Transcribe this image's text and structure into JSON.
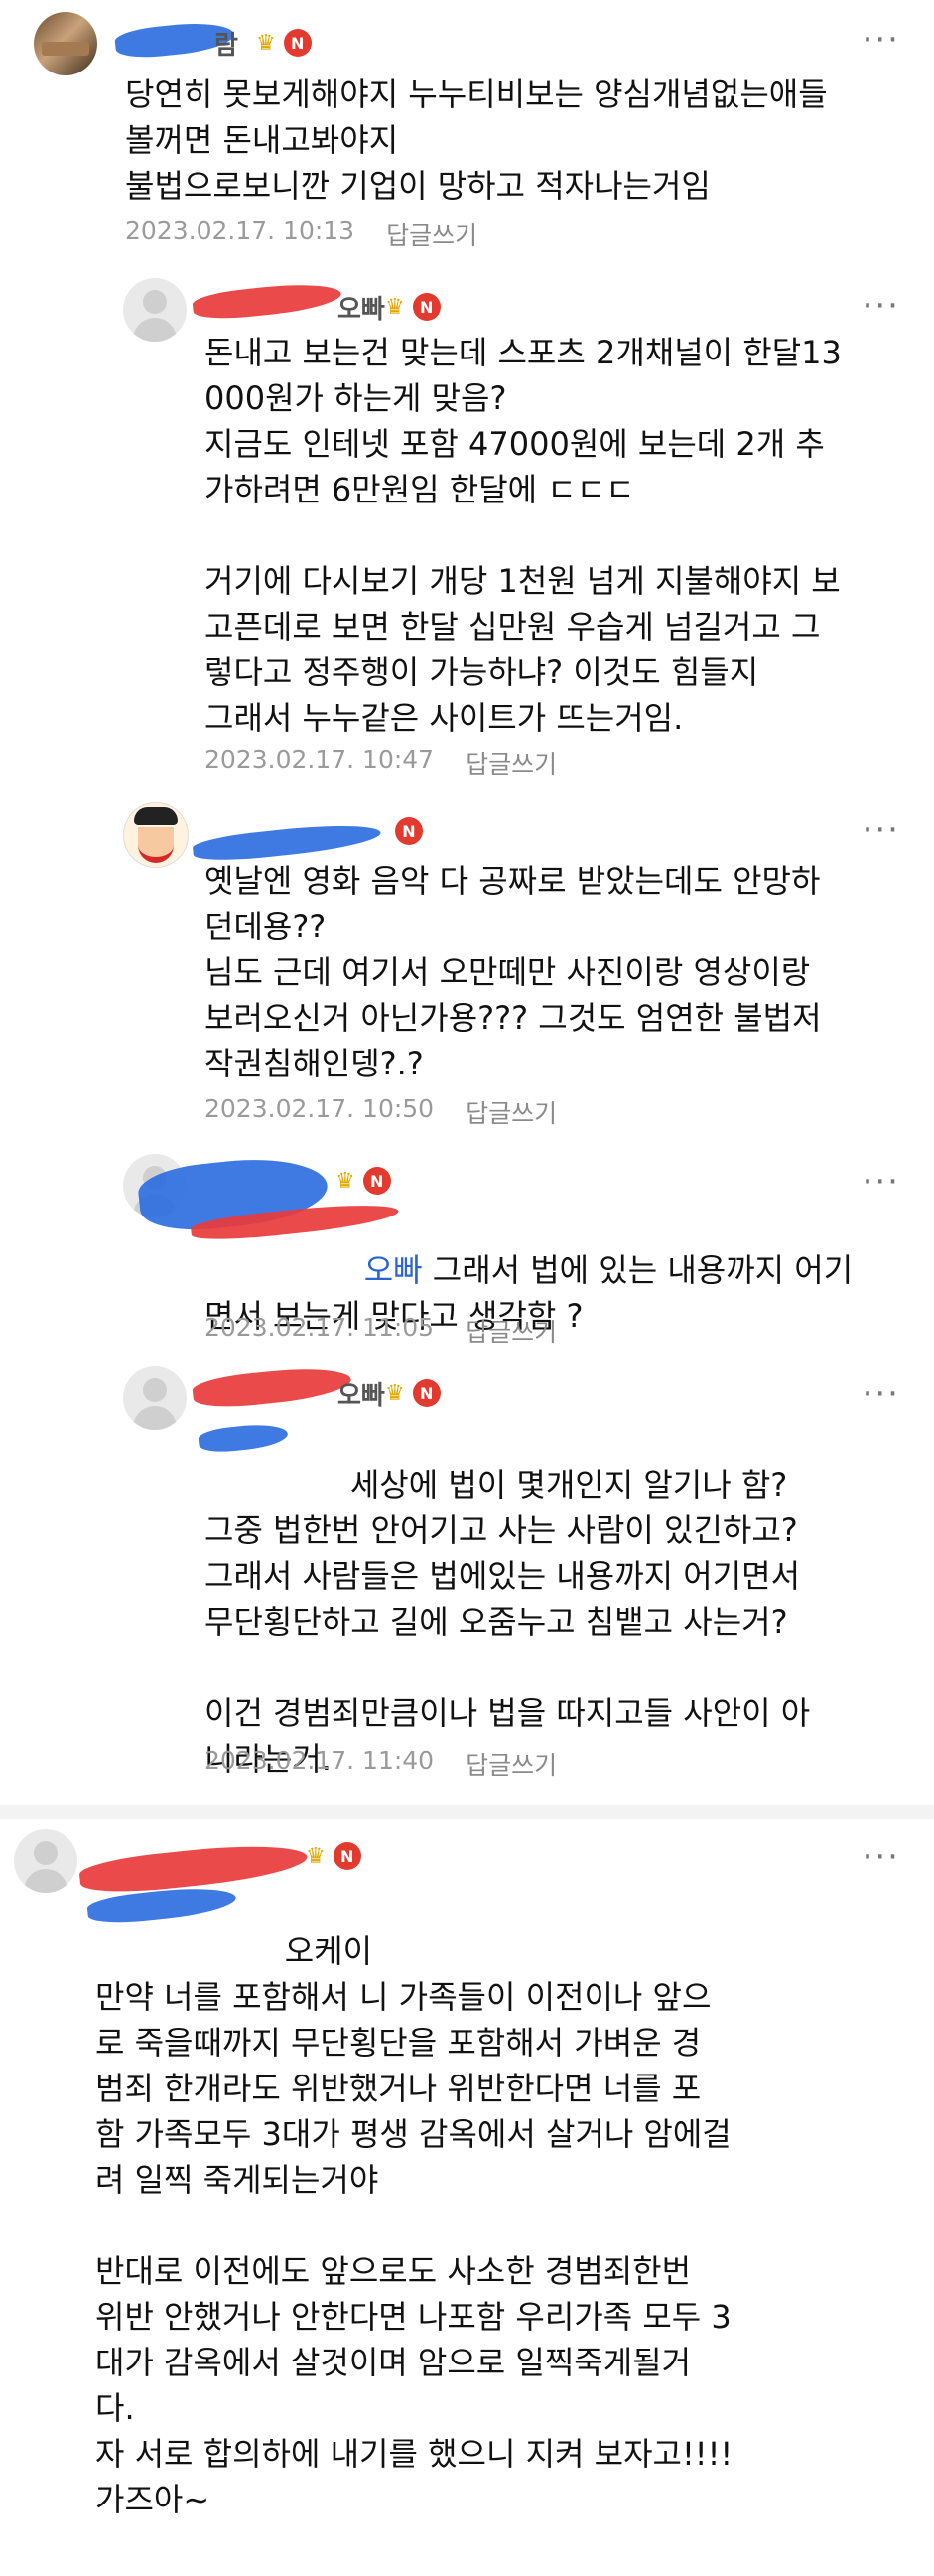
{
  "comments": [
    {
      "body": "당연히 못보게해야지 누누티비보는 양심개념없는애들\n볼꺼면 돈내고봐야지\n불법으로보니깐 기업이 망하고 적자나는거임",
      "date": "2023.02.17. 10:13",
      "reply_label": "답글쓰기",
      "nick": "람",
      "badge": "N"
    },
    {
      "body": "돈내고 보는건 맞는데 스포츠 2개채널이 한달13\n000원가 하는게 맞음?\n지금도 인테넷 포함 47000원에 보는데 2개 추\n가하려면 6만원임 한달에 ㄷㄷㄷ\n\n거기에 다시보기 개당 1천원 넘게 지불해야지 보\n고픈데로 보면 한달 십만원 우습게 넘길거고 그\n렇다고 정주행이 가능하냐? 이것도 힘들지\n그래서 누누같은 사이트가 뜨는거임.",
      "date": "2023.02.17. 10:47",
      "reply_label": "답글쓰기",
      "nick": "오빠",
      "badge": "N"
    },
    {
      "body": "옛날엔 영화 음악 다 공짜로 받았는데도 안망하\n던데용??\n님도 근데 여기서 오만떼만 사진이랑 영상이랑\n보러오신거 아닌가용??? 그것도 엄연한 불법저\n작권침해인뎅?.?",
      "date": "2023.02.17. 10:50",
      "reply_label": "답글쓰기",
      "nick": "",
      "badge": "N"
    },
    {
      "mention": "오빠",
      "body": " 그래서 법에 있는 내용까지 어기\n면서 보는게 맞다고 생각함 ?",
      "date": "2023.02.17. 11:05",
      "reply_label": "답글쓰기",
      "nick": "",
      "badge": "N"
    },
    {
      "mention": "",
      "body": " 세상에 법이 몇개인지 알기나 함?\n그중 법한번 안어기고 사는 사람이 있긴하고?\n그래서 사람들은 법에있는 내용까지 어기면서\n무단횡단하고 길에 오줌누고 침뱉고 사는거?\n\n이건 경범죄만큼이나 법을 따지고들 사안이 아\n니라는거.",
      "date": "2023.02.17. 11:40",
      "reply_label": "답글쓰기",
      "nick": "오빠",
      "badge": "N"
    },
    {
      "mention": "",
      "body": "오케이\n만약 너를 포함해서 니 가족들이 이전이나 앞으\n로 죽을때까지 무단횡단을 포함해서 가벼운 경\n범죄 한개라도 위반했거나 위반한다면 너를 포\n함 가족모두 3대가 평생 감옥에서 살거나 암에걸\n려 일찍 죽게되는거야\n\n반대로 이전에도 앞으로도 사소한 경범죄한번\n위반 안했거나 안한다면 나포함 우리가족 모두 3\n대가 감옥에서 살것이며 암으로 일찍죽게될거\n다.\n자 서로 합의하에 내기를 했으니 지켜 보자고!!!!\n가즈아~",
      "nick": "",
      "badge": "N"
    }
  ],
  "icons": {
    "more": "more-icon",
    "crown": "crown-icon",
    "badge": "new-badge-icon"
  },
  "colors": {
    "badge": "#e33a2f",
    "mention": "#2a63d4",
    "crown": "#e0a800",
    "meta": "#9a9a9a"
  }
}
